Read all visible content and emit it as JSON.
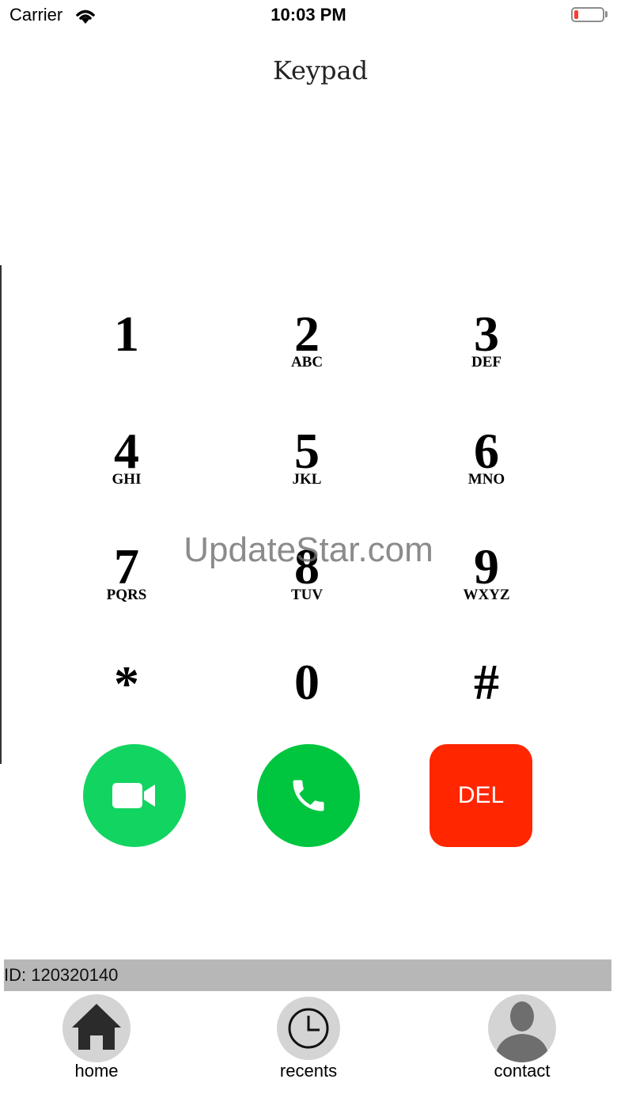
{
  "status_bar": {
    "carrier": "Carrier",
    "time": "10:03 PM"
  },
  "header": {
    "title": "Keypad"
  },
  "keypad": [
    {
      "num": "1",
      "sub": ""
    },
    {
      "num": "2",
      "sub": "ABC"
    },
    {
      "num": "3",
      "sub": "DEF"
    },
    {
      "num": "4",
      "sub": "GHI"
    },
    {
      "num": "5",
      "sub": "JKL"
    },
    {
      "num": "6",
      "sub": "MNO"
    },
    {
      "num": "7",
      "sub": "PQRS"
    },
    {
      "num": "8",
      "sub": "TUV"
    },
    {
      "num": "9",
      "sub": "WXYZ"
    },
    {
      "num": "*",
      "sub": ""
    },
    {
      "num": "0",
      "sub": ""
    },
    {
      "num": "#",
      "sub": ""
    }
  ],
  "watermark": "UpdateStar.com",
  "actions": {
    "del_label": "DEL"
  },
  "id_bar": {
    "text": "ID: 120320140"
  },
  "tabs": [
    {
      "label": "home",
      "icon": "home-icon"
    },
    {
      "label": "recents",
      "icon": "clock-icon"
    },
    {
      "label": "contact",
      "icon": "person-icon"
    }
  ],
  "colors": {
    "video": "#12d460",
    "call": "#00c53f",
    "delete": "#ff2600",
    "id_bar": "#b7b7b7"
  }
}
